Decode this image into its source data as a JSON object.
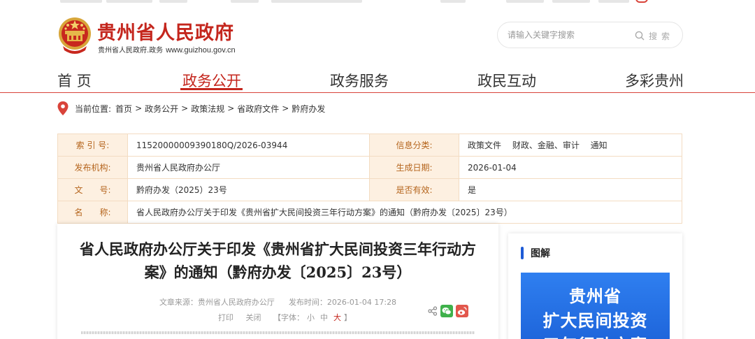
{
  "site": {
    "name": "贵州省人民政府",
    "subtitle": "贵州省人民政府.政务",
    "url": "www.guizhou.gov.cn"
  },
  "search": {
    "placeholder": "请输入关键字搜索",
    "button_label": "搜索"
  },
  "nav": {
    "items": [
      {
        "label": "首 页"
      },
      {
        "label": "政务公开"
      },
      {
        "label": "政务服务"
      },
      {
        "label": "政民互动"
      },
      {
        "label": "多彩贵州"
      }
    ],
    "active_index": 1
  },
  "breadcrumb": {
    "prefix": "当前位置:",
    "items": [
      "首页",
      "政务公开",
      "政策法规",
      "省政府文件",
      "黔府办发"
    ],
    "separator": ">"
  },
  "metadata": {
    "index_label": "索 引 号:",
    "index_value": "11520000009390180Q/2026-03944",
    "category_label": "信息分类:",
    "category_value": "政策文件　 财政、金融、审计　 通知",
    "issuer_label": "发布机构:",
    "issuer_value": "贵州省人民政府办公厅",
    "date_label": "生成日期:",
    "date_value": "2026-01-04",
    "doc_no_label": "文　　号:",
    "doc_no_value": "黔府办发（2025）23号",
    "valid_label": "是否有效:",
    "valid_value": "是",
    "name_label": "名　　称:",
    "name_value": "省人民政府办公厅关于印发《贵州省扩大民间投资三年行动方案》的通知（黔府办发〔2025〕23号）"
  },
  "article": {
    "title": "省人民政府办公厅关于印发《贵州省扩大民间投资三年行动方案》的通知（黔府办发〔2025〕23号）",
    "source": "文章来源：贵州省人民政府办公厅",
    "published": "发布时间：2026-01-04 17:28",
    "print_label": "打印",
    "close_label": "关闭",
    "font_prefix": "【字体：",
    "font_small": "小",
    "font_medium": "中",
    "font_large": "大",
    "font_suffix": "】"
  },
  "sidebar": {
    "heading": "图解",
    "banner_line1": "贵州省",
    "banner_line2": "扩大民间投资",
    "banner_line3": "三年行动方案"
  },
  "colors": {
    "brand_red": "#c4261d",
    "meta_label": "#b5651d",
    "meta_bg": "#fdf0e1",
    "accent_blue": "#1e5bd6"
  }
}
